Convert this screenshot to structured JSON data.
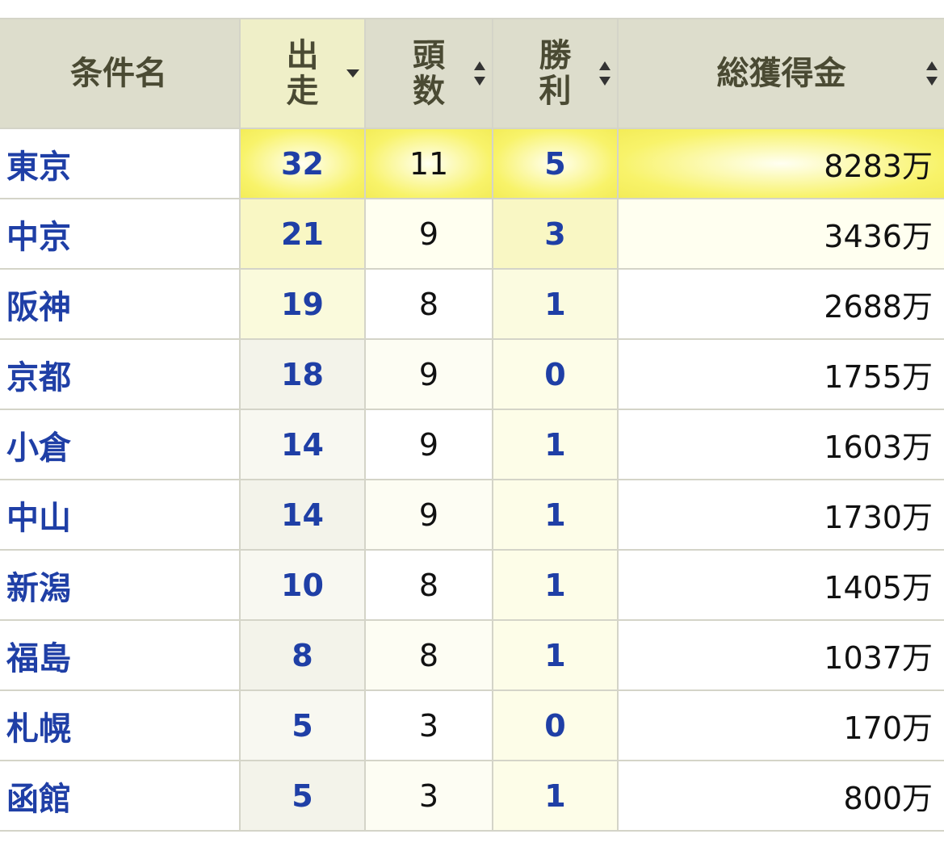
{
  "headers": {
    "name": "条件名",
    "runs": "出走",
    "heads": "頭数",
    "wins": "勝利",
    "prize": "総獲得金"
  },
  "rows": [
    {
      "name": "東京",
      "runs": "32",
      "heads": "11",
      "wins": "5",
      "prize": "8283万"
    },
    {
      "name": "中京",
      "runs": "21",
      "heads": "9",
      "wins": "3",
      "prize": "3436万"
    },
    {
      "name": "阪神",
      "runs": "19",
      "heads": "8",
      "wins": "1",
      "prize": "2688万"
    },
    {
      "name": "京都",
      "runs": "18",
      "heads": "9",
      "wins": "0",
      "prize": "1755万"
    },
    {
      "name": "小倉",
      "runs": "14",
      "heads": "9",
      "wins": "1",
      "prize": "1603万"
    },
    {
      "name": "中山",
      "runs": "14",
      "heads": "9",
      "wins": "1",
      "prize": "1730万"
    },
    {
      "name": "新潟",
      "runs": "10",
      "heads": "8",
      "wins": "1",
      "prize": "1405万"
    },
    {
      "name": "福島",
      "runs": "8",
      "heads": "8",
      "wins": "1",
      "prize": "1037万"
    },
    {
      "name": "札幌",
      "runs": "5",
      "heads": "3",
      "wins": "0",
      "prize": "170万"
    },
    {
      "name": "函館",
      "runs": "5",
      "heads": "3",
      "wins": "1",
      "prize": "800万"
    }
  ],
  "colors": {
    "link": "#1f3fa6",
    "header_bg": "#ddddcc",
    "highlight": "#f8f36a"
  },
  "icons": {
    "sorted_column": "caret-down-icon",
    "sortable_column": "sort-arrows-icon"
  }
}
